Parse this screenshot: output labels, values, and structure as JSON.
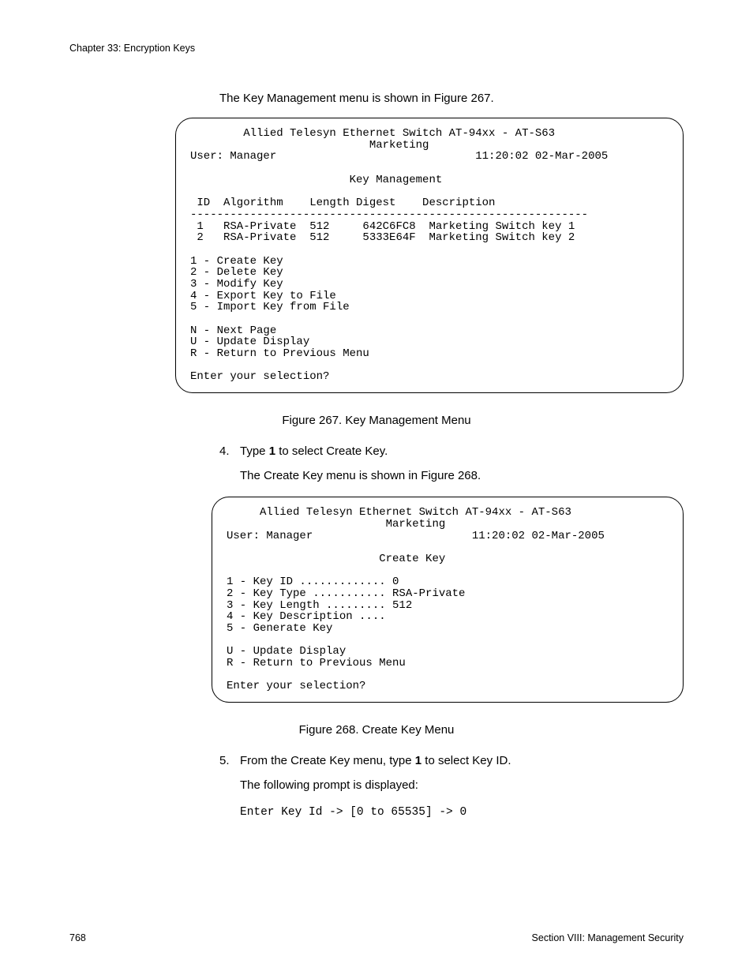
{
  "header": "Chapter 33: Encryption Keys",
  "intro": "The Key Management menu is shown in Figure 267.",
  "terminal1": {
    "title_l1": "Allied Telesyn Ethernet Switch AT-94xx - AT-S63",
    "title_l2": "Marketing",
    "user_label": "User: Manager",
    "datetime": "11:20:02 02-Mar-2005",
    "screen_title": "Key Management",
    "columns": " ID  Algorithm    Length Digest    Description",
    "divider": "------------------------------------------------------------",
    "rows": [
      " 1   RSA-Private  512     642C6FC8  Marketing Switch key 1",
      " 2   RSA-Private  512     5333E64F  Marketing Switch key 2"
    ],
    "menu": [
      "1 - Create Key",
      "2 - Delete Key",
      "3 - Modify Key",
      "4 - Export Key to File",
      "5 - Import Key from File"
    ],
    "nav": [
      "N - Next Page",
      "U - Update Display",
      "R - Return to Previous Menu"
    ],
    "prompt": "Enter your selection?"
  },
  "caption1": "Figure 267. Key Management Menu",
  "step4_num": "4.",
  "step4_a": "Type ",
  "step4_bold": "1",
  "step4_b": " to select Create Key.",
  "step4_sub": "The Create Key menu is shown in Figure 268.",
  "terminal2": {
    "title_l1": "Allied Telesyn Ethernet Switch AT-94xx - AT-S63",
    "title_l2": "Marketing",
    "user_label": "User: Manager",
    "datetime": "11:20:02 02-Mar-2005",
    "screen_title": "Create Key",
    "menu": [
      "1 - Key ID ............. 0",
      "2 - Key Type ........... RSA-Private",
      "3 - Key Length ......... 512",
      "4 - Key Description ....",
      "5 - Generate Key"
    ],
    "nav": [
      "U - Update Display",
      "R - Return to Previous Menu"
    ],
    "prompt": "Enter your selection?"
  },
  "caption2": "Figure 268. Create Key Menu",
  "step5_num": "5.",
  "step5_a": "From the Create Key menu, type ",
  "step5_bold": "1",
  "step5_b": " to select Key ID.",
  "step5_sub": "The following prompt is displayed:",
  "prompt_line": "Enter Key Id -> [0 to 65535] -> 0",
  "footer_left": "768",
  "footer_right": "Section VIII: Management Security"
}
